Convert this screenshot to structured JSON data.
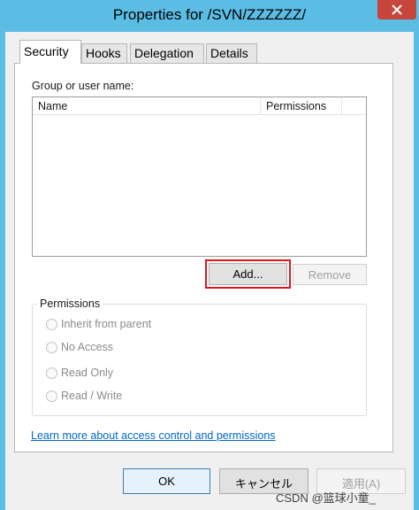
{
  "window": {
    "title": "Properties for /SVN/ZZZZZZ/"
  },
  "tabs": [
    {
      "label": "Security",
      "active": true
    },
    {
      "label": "Hooks",
      "active": false
    },
    {
      "label": "Delegation",
      "active": false
    },
    {
      "label": "Details",
      "active": false
    }
  ],
  "security": {
    "group_label": "Group or user name:",
    "columns": {
      "name": "Name",
      "permissions": "Permissions"
    },
    "add_button": "Add...",
    "remove_button": "Remove",
    "permissions_group": "Permissions",
    "radio_options": {
      "inherit": "Inherit from parent",
      "no_access": "No Access",
      "read_only": "Read Only",
      "read_write": "Read / Write"
    },
    "help_link": "Learn more about access control and permissions"
  },
  "footer": {
    "ok": "OK",
    "cancel": "キャンセル",
    "apply": "適用(A)"
  },
  "watermark": "CSDN @篮球小童_",
  "colors": {
    "titlebar": "#5bbce4",
    "close": "#c7463b",
    "highlight": "#e2141c",
    "link": "#0066cc"
  }
}
